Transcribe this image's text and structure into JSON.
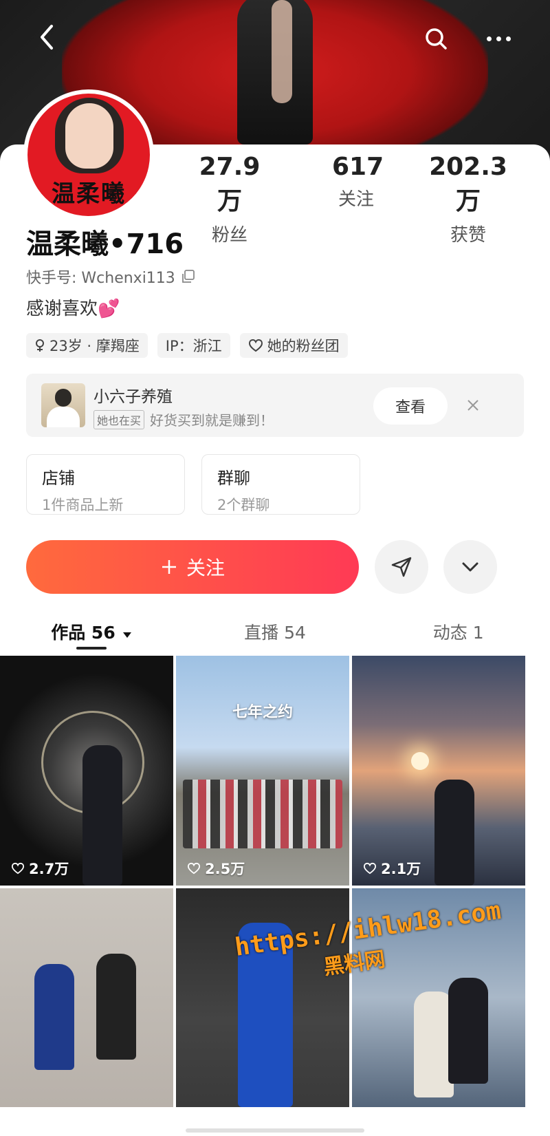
{
  "profile": {
    "avatar_text": "温柔曦",
    "name": "温柔曦•716",
    "uid_label": "快手号: Wchenxi113",
    "bio": "感谢喜欢💕",
    "stats": [
      {
        "num": "27.9万",
        "label": "粉丝"
      },
      {
        "num": "617",
        "label": "关注"
      },
      {
        "num": "202.3万",
        "label": "获赞"
      }
    ],
    "tags": [
      {
        "icon": "female-icon",
        "text": "23岁 · 摩羯座"
      },
      {
        "icon": "",
        "text": "IP：浙江"
      },
      {
        "icon": "heart-outline-icon",
        "text": "她的粉丝团"
      }
    ]
  },
  "promo": {
    "title": "小六子养殖",
    "badge": "她也在买",
    "subtitle": "好货买到就是赚到！",
    "view_label": "查看"
  },
  "boxes": [
    {
      "title": "店铺",
      "subtitle": "1件商品上新"
    },
    {
      "title": "群聊",
      "subtitle": "2个群聊"
    }
  ],
  "actions": {
    "follow_label": "关注"
  },
  "tabs": [
    {
      "label": "作品 56"
    },
    {
      "label": "直播 54"
    },
    {
      "label": "动态 1"
    }
  ],
  "grid": [
    {
      "likes": "2.7万",
      "caption": ""
    },
    {
      "likes": "2.5万",
      "caption": "七年之约"
    },
    {
      "likes": "2.1万",
      "caption": ""
    },
    {
      "likes": "",
      "caption": ""
    },
    {
      "likes": "",
      "caption": ""
    },
    {
      "likes": "",
      "caption": ""
    }
  ],
  "watermark": {
    "url": "https://ihlw18.com",
    "text": "黑料网"
  },
  "colors": {
    "follow_start": "#ff6a3d",
    "follow_end": "#ff3a55",
    "avatar_bg": "#e21a23"
  }
}
